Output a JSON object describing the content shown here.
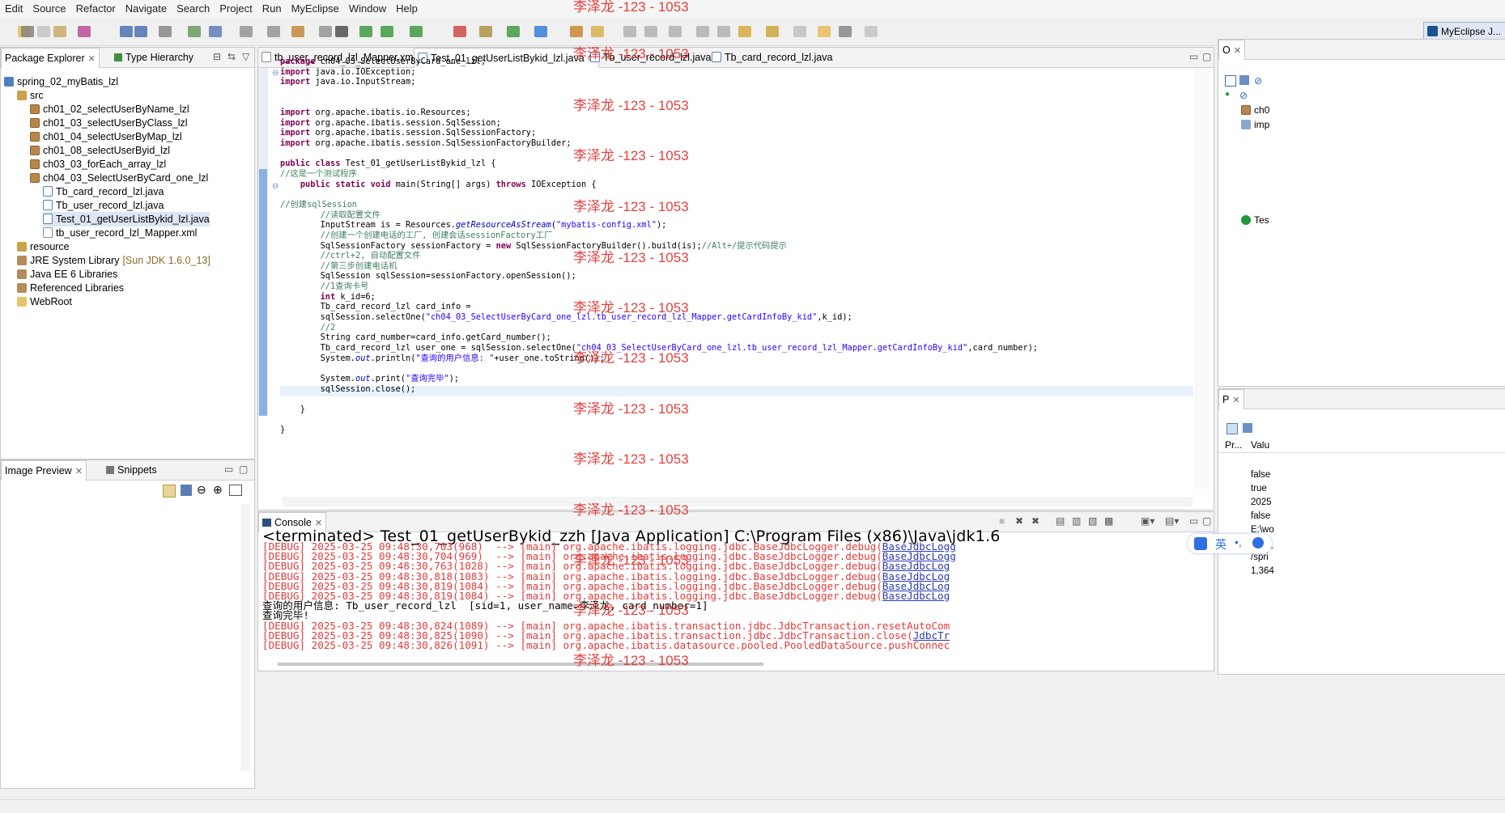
{
  "menu": [
    "Edit",
    "Source",
    "Refactor",
    "Navigate",
    "Search",
    "Project",
    "Run",
    "MyEclipse",
    "Window",
    "Help"
  ],
  "perspective_label": "MyEclipse J...",
  "watermark": "李泽龙 -123 - 1053",
  "package_explorer": {
    "tab_label": "Package Explorer",
    "type_hierarchy_label": "Type Hierarchy",
    "tree": [
      {
        "label": "spring_02_myBatis_lzl",
        "icon": "project-icon"
      },
      {
        "label": "src",
        "icon": "source-folder-icon"
      },
      {
        "label": "ch01_02_selectUserByName_lzl",
        "icon": "package-icon"
      },
      {
        "label": "ch01_03_selectUserByClass_lzl",
        "icon": "package-icon"
      },
      {
        "label": "ch01_04_selectUserByMap_lzl",
        "icon": "package-icon"
      },
      {
        "label": "ch01_08_selectUserByid_lzl",
        "icon": "package-icon"
      },
      {
        "label": "ch03_03_forEach_array_lzl",
        "icon": "package-icon"
      },
      {
        "label": "ch04_03_SelectUserByCard_one_lzl",
        "icon": "package-icon"
      },
      {
        "label": "Tb_card_record_lzl.java",
        "icon": "java-file-icon"
      },
      {
        "label": "Tb_user_record_lzl.java",
        "icon": "java-file-icon"
      },
      {
        "label": "Test_01_getUserListBykid_lzl.java",
        "icon": "java-file-icon"
      },
      {
        "label": "tb_user_record_lzl_Mapper.xml",
        "icon": "xml-file-icon"
      },
      {
        "label": "resource",
        "icon": "source-folder-icon"
      },
      {
        "label": "JRE System Library",
        "suffix": "[Sun JDK 1.6.0_13]",
        "icon": "library-icon"
      },
      {
        "label": "Java EE 6 Libraries",
        "icon": "library-icon"
      },
      {
        "label": "Referenced Libraries",
        "icon": "library-icon"
      },
      {
        "label": "WebRoot",
        "icon": "folder-icon"
      }
    ]
  },
  "image_preview": {
    "tab_label": "Image Preview",
    "snippets_label": "Snippets"
  },
  "editor_tabs": [
    {
      "label": "tb_user_record_lzl_Mapper.xml"
    },
    {
      "label": "Test_01_getUserListBykid_lzl.java"
    },
    {
      "label": "Tb_user_record_lzl.java"
    },
    {
      "label": "Tb_card_record_lzl.java"
    }
  ],
  "code_lines": [
    [
      [
        "kw",
        "package"
      ],
      [
        "t",
        " ch04_03_SelectUserByCard_one_lzl;"
      ]
    ],
    [
      [
        "kw",
        "import"
      ],
      [
        "t",
        " java.io.IOException;"
      ]
    ],
    [
      [
        "kw",
        "import"
      ],
      [
        "t",
        " java.io.InputStream;"
      ]
    ],
    [],
    [],
    [
      [
        "kw",
        "import"
      ],
      [
        "t",
        " org.apache.ibatis.io.Resources;"
      ]
    ],
    [
      [
        "kw",
        "import"
      ],
      [
        "t",
        " org.apache.ibatis.session.SqlSession;"
      ]
    ],
    [
      [
        "kw",
        "import"
      ],
      [
        "t",
        " org.apache.ibatis.session.SqlSessionFactory;"
      ]
    ],
    [
      [
        "kw",
        "import"
      ],
      [
        "t",
        " org.apache.ibatis.session.SqlSessionFactoryBuilder;"
      ]
    ],
    [],
    [
      [
        "kw",
        "public class"
      ],
      [
        "t",
        " Test_01_getUserListBykid_lzl {"
      ]
    ],
    [
      [
        "cmt",
        "//这是一个测试程序"
      ]
    ],
    [
      [
        "t",
        "    "
      ],
      [
        "kw",
        "public static void"
      ],
      [
        "t",
        " main(String[] args) "
      ],
      [
        "kw",
        "throws"
      ],
      [
        "t",
        " IOException {"
      ]
    ],
    [],
    [
      [
        "cmt",
        "//创建sqlSession"
      ]
    ],
    [
      [
        "t",
        "        "
      ],
      [
        "cmt",
        "//读取配置文件"
      ]
    ],
    [
      [
        "t",
        "        InputStream is = Resources."
      ],
      [
        "it",
        "getResourceAsStream"
      ],
      [
        "t",
        "("
      ],
      [
        "str",
        "\"mybatis-config.xml\""
      ],
      [
        "t",
        ");"
      ]
    ],
    [
      [
        "t",
        "        "
      ],
      [
        "cmt",
        "//创建一个创建电话的工厂, 创建会话sessionFactory工厂"
      ]
    ],
    [
      [
        "t",
        "        SqlSessionFactory sessionFactory = "
      ],
      [
        "kw",
        "new"
      ],
      [
        "t",
        " SqlSessionFactoryBuilder().build(is);"
      ],
      [
        "cmt",
        "//Alt+/提示代码提示"
      ]
    ],
    [
      [
        "t",
        "        "
      ],
      [
        "cmt",
        "//ctrl+2, 自动配置文件"
      ]
    ],
    [
      [
        "t",
        "        "
      ],
      [
        "cmt",
        "//第三步创建电话机"
      ]
    ],
    [
      [
        "t",
        "        SqlSession sqlSession=sessionFactory.openSession();"
      ]
    ],
    [
      [
        "t",
        "        "
      ],
      [
        "cmt",
        "//1查询卡号"
      ]
    ],
    [
      [
        "t",
        "        "
      ],
      [
        "kw",
        "int"
      ],
      [
        "t",
        " k_id=6;"
      ]
    ],
    [
      [
        "t",
        "        Tb_card_record_lzl card_info ="
      ]
    ],
    [
      [
        "t",
        "        sqlSession.selectOne("
      ],
      [
        "str",
        "\"ch04_03_SelectUserByCard_one_lzl.tb_user_record_lzl_Mapper.getCardInfoBy_kid\""
      ],
      [
        "t",
        ",k_id);"
      ]
    ],
    [
      [
        "t",
        "        "
      ],
      [
        "cmt",
        "//2"
      ]
    ],
    [
      [
        "t",
        "        String card_number=card_info.getCard_number();"
      ]
    ],
    [
      [
        "t",
        "        Tb_card_record_lzl user_one = sqlSession.selectOne("
      ],
      [
        "str",
        "\"ch04_03_SelectUserByCard_one_lzl.tb_user_record_lzl_Mapper.getCardInfoBy_kid\""
      ],
      [
        "t",
        ",card_number);"
      ]
    ],
    [
      [
        "t",
        "        System."
      ],
      [
        "it",
        "out"
      ],
      [
        "t",
        ".println("
      ],
      [
        "str",
        "\"查询的用户信息: \""
      ],
      [
        "t",
        "+user_one.toString());"
      ]
    ],
    [],
    [
      [
        "t",
        "        System."
      ],
      [
        "it",
        "out"
      ],
      [
        "t",
        ".print("
      ],
      [
        "str",
        "\"查询完毕\""
      ],
      [
        "t",
        ");"
      ]
    ],
    [
      [
        "t",
        "        sqlSession.close();"
      ]
    ],
    [],
    [
      [
        "t",
        "    }"
      ]
    ],
    [],
    [
      [
        "t",
        "}"
      ]
    ]
  ],
  "console": {
    "tab_label": "Console",
    "title": "<terminated> Test_01_getUserBykid_zzh [Java Application] C:\\Program Files (x86)\\Java\\jdk1.6",
    "lines": [
      {
        "kind": "dbg",
        "text": "[DEBUG] 2025-03-25 09:48:30,703(968)  --> [main] org.apache.ibatis.logging.jdbc.BaseJdbcLogger.debug(",
        "link": "BaseJdbcLogg"
      },
      {
        "kind": "dbg",
        "text": "[DEBUG] 2025-03-25 09:48:30,704(969)  --> [main] org.apache.ibatis.logging.jdbc.BaseJdbcLogger.debug(",
        "link": "BaseJdbcLogg"
      },
      {
        "kind": "dbg",
        "text": "[DEBUG] 2025-03-25 09:48:30,763(1028) --> [main] org.apache.ibatis.logging.jdbc.BaseJdbcLogger.debug(",
        "link": "BaseJdbcLog"
      },
      {
        "kind": "dbg",
        "text": "[DEBUG] 2025-03-25 09:48:30,818(1083) --> [main] org.apache.ibatis.logging.jdbc.BaseJdbcLogger.debug(",
        "link": "BaseJdbcLog"
      },
      {
        "kind": "dbg",
        "text": "[DEBUG] 2025-03-25 09:48:30,819(1084) --> [main] org.apache.ibatis.logging.jdbc.BaseJdbcLogger.debug(",
        "link": "BaseJdbcLog"
      },
      {
        "kind": "dbg",
        "text": "[DEBUG] 2025-03-25 09:48:30,819(1084) --> [main] org.apache.ibatis.logging.jdbc.BaseJdbcLogger.debug(",
        "link": "BaseJdbcLog"
      },
      {
        "kind": "out",
        "text": "查询的用户信息: Tb_user_record_lzl  [sid=1, user_name=李泽龙, card_number=1]",
        "link": ""
      },
      {
        "kind": "out",
        "text": "查询完毕!",
        "link": ""
      },
      {
        "kind": "dbg",
        "text": "[DEBUG] 2025-03-25 09:48:30,824(1089) --> [main] org.apache.ibatis.transaction.jdbc.JdbcTransaction.resetAutoCom",
        "link": ""
      },
      {
        "kind": "dbg",
        "text": "[DEBUG] 2025-03-25 09:48:30,825(1090) --> [main] org.apache.ibatis.transaction.jdbc.JdbcTransaction.close(",
        "link": "JdbcTr"
      },
      {
        "kind": "dbg",
        "text": "[DEBUG] 2025-03-25 09:48:30,826(1091) --> [main] org.apache.ibatis.datasource.pooled.PooledDataSource.pushConnec",
        "link": ""
      }
    ]
  },
  "outline": {
    "tab_label": "O",
    "items": [
      "ch0",
      "imp",
      "Tes"
    ]
  },
  "properties": {
    "tab_label": "P",
    "col_property": "Pr...",
    "col_value": "Valu",
    "values": [
      "false",
      "true",
      "2025",
      "false",
      "E:\\wo",
      "Test_",
      "/spri",
      "1,364"
    ]
  },
  "ime": {
    "lang": "英"
  }
}
